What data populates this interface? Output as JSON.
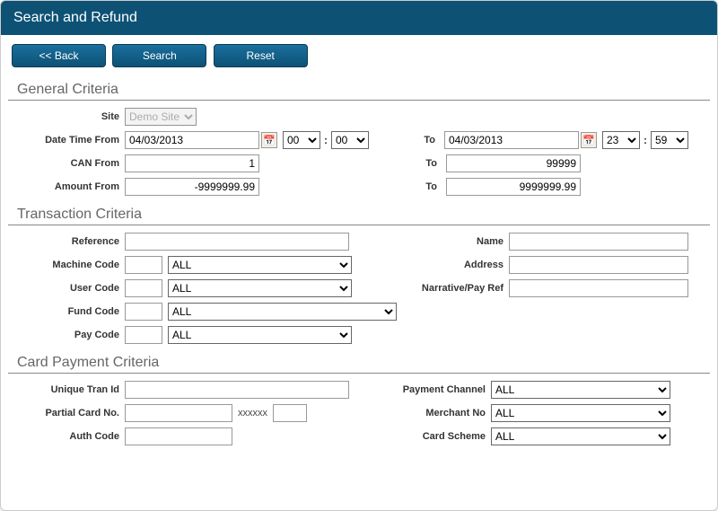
{
  "header": {
    "title": "Search and Refund"
  },
  "toolbar": {
    "back": "<< Back",
    "search": "Search",
    "reset": "Reset"
  },
  "sections": {
    "general": "General Criteria",
    "transaction": "Transaction Criteria",
    "card": "Card Payment Criteria"
  },
  "general": {
    "site_label": "Site",
    "site_value": "Demo Site",
    "date_from_label": "Date Time From",
    "date_from_value": "04/03/2013",
    "hour_from": "00",
    "min_from": "00",
    "date_to_label": "To",
    "date_to_value": "04/03/2013",
    "hour_to": "23",
    "min_to": "59",
    "can_from_label": "CAN From",
    "can_from_value": "1",
    "can_to_label": "To",
    "can_to_value": "99999",
    "amount_from_label": "Amount From",
    "amount_from_value": "-9999999.99",
    "amount_to_label": "To",
    "amount_to_value": "9999999.99"
  },
  "transaction": {
    "reference_label": "Reference",
    "reference_value": "",
    "name_label": "Name",
    "name_value": "",
    "machine_label": "Machine Code",
    "machine_code": "",
    "machine_sel": "ALL",
    "address_label": "Address",
    "address_value": "",
    "user_label": "User Code",
    "user_code": "",
    "user_sel": "ALL",
    "narrative_label": "Narrative/Pay Ref",
    "narrative_value": "",
    "fund_label": "Fund Code",
    "fund_code": "",
    "fund_sel": "ALL",
    "pay_label": "Pay Code",
    "pay_code": "",
    "pay_sel": "ALL"
  },
  "card": {
    "utid_label": "Unique Tran Id",
    "utid_value": "",
    "channel_label": "Payment Channel",
    "channel_sel": "ALL",
    "partial_label": "Partial Card No.",
    "partial_prefix": "",
    "partial_mask": "xxxxxx",
    "partial_suffix": "",
    "merchant_label": "Merchant No",
    "merchant_sel": "ALL",
    "auth_label": "Auth Code",
    "auth_value": "",
    "scheme_label": "Card Scheme",
    "scheme_sel": "ALL"
  }
}
